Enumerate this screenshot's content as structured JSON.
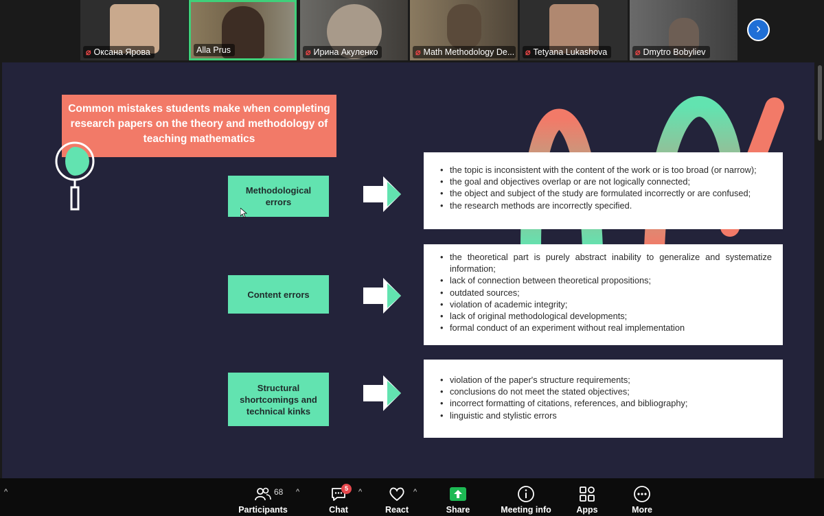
{
  "participants_strip": [
    {
      "name": "Оксана Ярова",
      "muted": true,
      "bg": "#2e2e2e",
      "face": "#c9a98d"
    },
    {
      "name": "Alla Prus",
      "muted": false,
      "active": true,
      "bg": "#7a6a4e",
      "face": "#3d2d24"
    },
    {
      "name": "Ирина Акуленко",
      "muted": true,
      "bg": "#4d4a45",
      "face": "#a89a8a"
    },
    {
      "name": "Math Methodology De...",
      "muted": true,
      "bg": "#6b5b45",
      "face": "#5a4a3a"
    },
    {
      "name": "Tetyana Lukashova",
      "muted": true,
      "bg": "#2e2e2e",
      "face": "#b08870"
    },
    {
      "name": "Dmytro Bobyliev",
      "muted": true,
      "bg": "#4b4b4b",
      "face": "#6d5e54"
    }
  ],
  "slide": {
    "title": "Common mistakes students make when completing research papers on the theory and methodology of teaching mathematics",
    "colors": {
      "coral": "#f27a68",
      "mint": "#62e3b0",
      "background": "#23233a"
    },
    "sections": [
      {
        "label": "Methodological errors",
        "items": [
          "the topic is inconsistent with the content of the work or is too broad (or narrow);",
          "the goal and objectives overlap or are not logically connected;",
          "the object and subject of the study are formulated incorrectly or are confused;",
          "the research methods are incorrectly specified."
        ]
      },
      {
        "label": "Content errors",
        "items": [
          "the theoretical part is purely abstract inability to generalize and systematize information;",
          "lack of connection between theoretical propositions;",
          "outdated sources;",
          "violation of academic integrity;",
          "lack of original methodological developments;",
          "formal conduct of an experiment without real implementation"
        ]
      },
      {
        "label": "Structural shortcomings and technical kinks",
        "items": [
          "violation of the paper's structure requirements;",
          "conclusions do not meet the stated objectives;",
          "incorrect formatting of citations, references, and bibliography;",
          "linguistic and stylistic errors"
        ]
      }
    ]
  },
  "toolbar": {
    "participants_label": "Participants",
    "participants_count": "68",
    "chat_label": "Chat",
    "chat_badge": "5",
    "react_label": "React",
    "share_label": "Share",
    "meeting_info_label": "Meeting info",
    "apps_label": "Apps",
    "more_label": "More",
    "share_color": "#1db954"
  }
}
